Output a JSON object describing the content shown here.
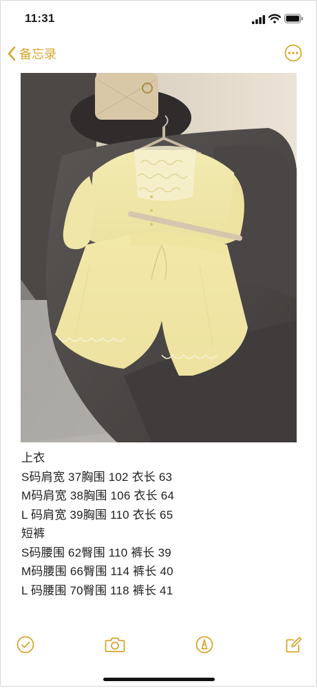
{
  "status_bar": {
    "time": "11:31",
    "icons": [
      "cellular-signal-icon",
      "wifi-icon",
      "battery-icon"
    ]
  },
  "nav": {
    "back_label": "备忘录",
    "back_icon": "chevron-left-icon",
    "more_icon": "ellipsis-circle-icon",
    "accent_color": "#d7a62c"
  },
  "photo": {
    "subject": "yellow lace blouse and shorts set on hanger over grey leather chair",
    "icon": "clothing-photo"
  },
  "note": {
    "lines": [
      "上衣",
      "S码肩宽 37胸围 102 衣长 63",
      "M码肩宽 38胸围 106 衣长 64",
      "L 码肩宽 39胸围 110 衣长 65",
      "短裤",
      "S码腰围 62臀围 110 裤长 39",
      "M码腰围 66臀围 114 裤长 40",
      "L 码腰围 70臀围 118 裤长 41"
    ]
  },
  "toolbar": {
    "items": [
      {
        "icon": "checklist-icon"
      },
      {
        "icon": "camera-icon"
      },
      {
        "icon": "markup-pen-icon"
      },
      {
        "icon": "compose-icon"
      }
    ]
  }
}
